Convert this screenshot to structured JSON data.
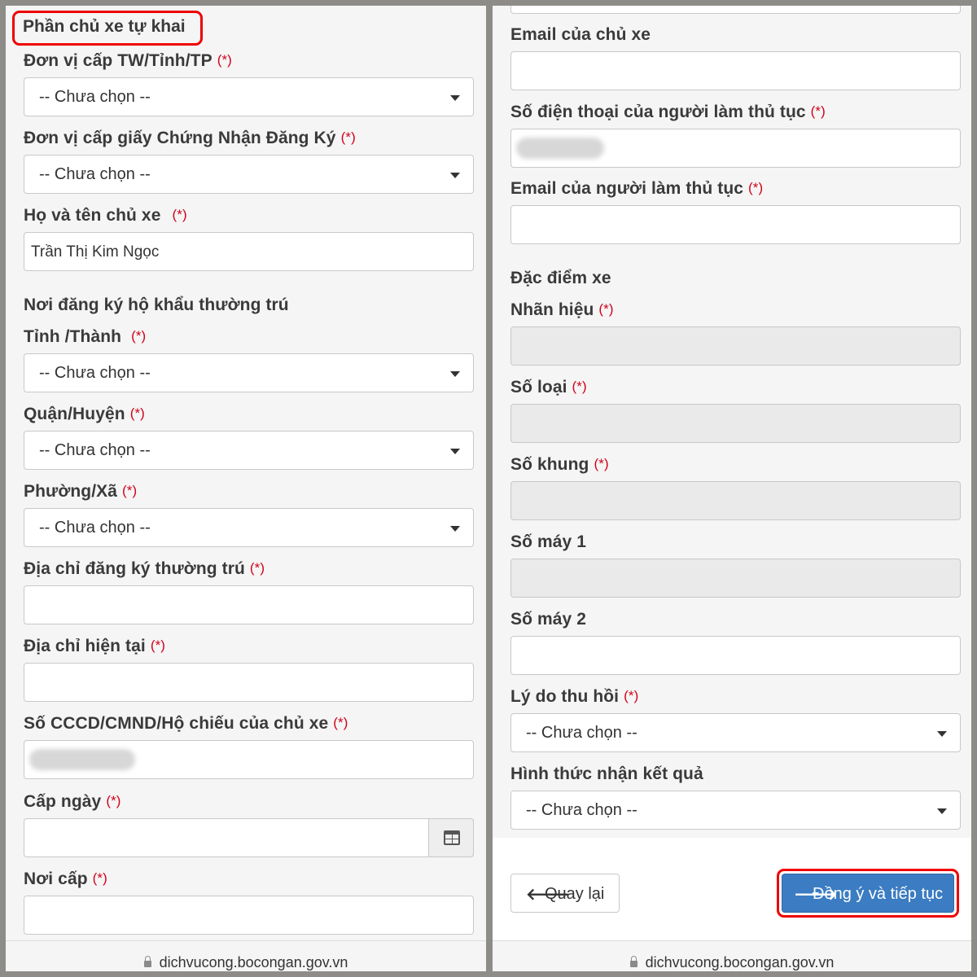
{
  "left": {
    "section_title": "Phần chủ xe tự khai",
    "fields": [
      {
        "label": "Đơn vị cấp TW/Tỉnh/TP",
        "required": "(*)",
        "value": "-- Chưa chọn --"
      },
      {
        "label": "Đơn vị cấp giấy Chứng Nhận Đăng Ký",
        "required": "(*)",
        "value": "-- Chưa chọn --"
      },
      {
        "label": "Họ và tên chủ xe",
        "required": "(*)",
        "value": "Trần Thị Kim Ngọc"
      },
      {
        "label": "Nơi đăng ký hộ khẩu thường trú"
      },
      {
        "label": "Tỉnh /Thành",
        "required": "(*)",
        "value": "-- Chưa chọn --"
      },
      {
        "label": "Quận/Huyện",
        "required": "(*)",
        "value": "-- Chưa chọn --"
      },
      {
        "label": "Phường/Xã",
        "required": "(*)",
        "value": "-- Chưa chọn --"
      },
      {
        "label": "Địa chỉ đăng ký thường trú",
        "required": "(*)",
        "value": ""
      },
      {
        "label": "Địa chỉ hiện tại",
        "required": "(*)",
        "value": ""
      },
      {
        "label": "Số CCCD/CMND/Hộ chiếu của chủ xe",
        "required": "(*)"
      },
      {
        "label": "Cấp ngày",
        "required": "(*)",
        "value": ""
      },
      {
        "label": "Nơi cấp",
        "required": "(*)",
        "value": ""
      }
    ],
    "footer_url": "dichvucong.bocongan.gov.vn"
  },
  "right": {
    "fields": [
      {
        "label": "Email của chủ xe",
        "value": ""
      },
      {
        "label": "Số điện thoại của người làm thủ tục",
        "required": "(*)"
      },
      {
        "label": "Email của người làm thủ tục",
        "required": "(*)",
        "value": ""
      },
      {
        "label": "Đặc điểm xe"
      },
      {
        "label": "Nhãn hiệu",
        "required": "(*)",
        "value": ""
      },
      {
        "label": "Số loại",
        "required": "(*)",
        "value": ""
      },
      {
        "label": "Số khung",
        "required": "(*)",
        "value": ""
      },
      {
        "label": "Số máy 1",
        "value": ""
      },
      {
        "label": "Số máy 2",
        "value": ""
      },
      {
        "label": "Lý do thu hồi",
        "required": "(*)",
        "value": "-- Chưa chọn --"
      },
      {
        "label": "Hình thức nhận kết quả",
        "value": "-- Chưa chọn --"
      }
    ],
    "buttons": {
      "back": "Quay lại",
      "next": "Đồng ý và tiếp tục"
    },
    "footer_url": "dichvucong.bocongan.gov.vn"
  },
  "colors": {
    "required": "#d0021b",
    "primary_button": "#3b7cc2",
    "highlight": "#e00000"
  },
  "icons": [
    "calendar-icon",
    "arrow-left-icon",
    "arrow-right-icon",
    "lock-icon",
    "caret-down-icon"
  ]
}
